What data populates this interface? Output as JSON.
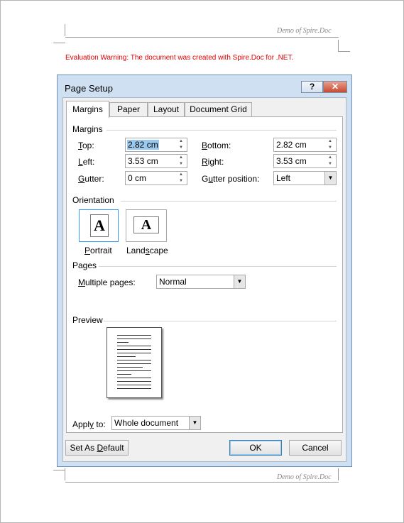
{
  "document": {
    "header_text": "Demo of Spire.Doc",
    "footer_text": "Demo of Spire.Doc",
    "evaluation_warning": "Evaluation Warning: The document was created with Spire.Doc for .NET."
  },
  "dialog": {
    "title": "Page Setup",
    "help_label": "?",
    "close_label": "✕",
    "tabs": [
      {
        "label": "Margins",
        "active": true
      },
      {
        "label": "Paper",
        "active": false
      },
      {
        "label": "Layout",
        "active": false
      },
      {
        "label": "Document Grid",
        "active": false
      }
    ],
    "margins": {
      "section_label": "Margins",
      "top": {
        "label": "Top:",
        "value": "2.82 cm"
      },
      "bottom": {
        "label": "Bottom:",
        "value": "2.82 cm"
      },
      "left": {
        "label": "Left:",
        "value": "3.53 cm"
      },
      "right": {
        "label": "Right:",
        "value": "3.53 cm"
      },
      "gutter": {
        "label": "Gutter:",
        "value": "0 cm"
      },
      "gutter_position": {
        "label": "Gutter position:",
        "value": "Left"
      }
    },
    "orientation": {
      "section_label": "Orientation",
      "portrait": {
        "label": "Portrait",
        "glyph": "A",
        "selected": true
      },
      "landscape": {
        "label": "Landscape",
        "glyph": "A",
        "selected": false
      }
    },
    "pages": {
      "section_label": "Pages",
      "multiple_pages_label": "Multiple pages:",
      "multiple_pages_value": "Normal"
    },
    "preview": {
      "section_label": "Preview"
    },
    "apply_to": {
      "label": "Apply to:",
      "value": "Whole document"
    },
    "buttons": {
      "set_default": "Set As Default",
      "ok": "OK",
      "cancel": "Cancel"
    }
  }
}
